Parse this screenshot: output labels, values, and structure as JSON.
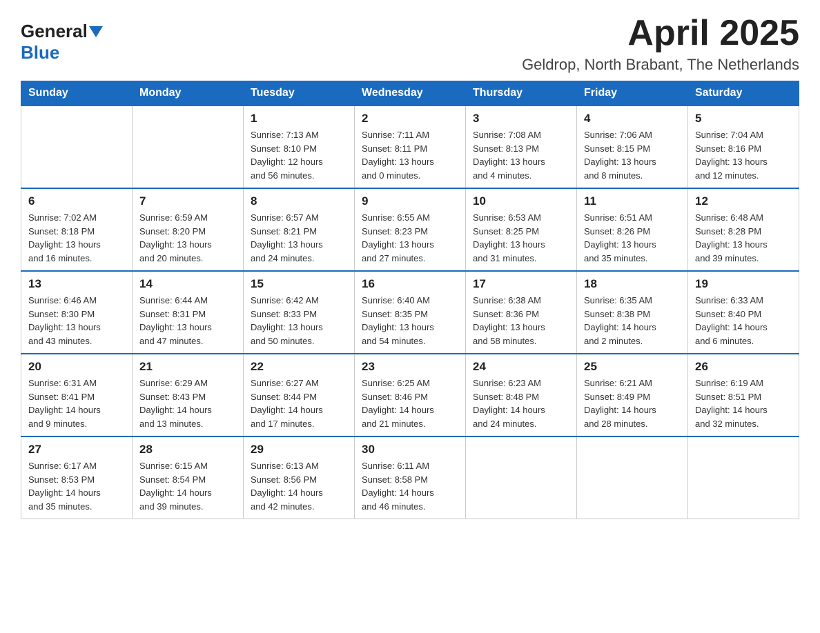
{
  "logo": {
    "general": "General",
    "blue": "Blue"
  },
  "header": {
    "month_year": "April 2025",
    "location": "Geldrop, North Brabant, The Netherlands"
  },
  "weekdays": [
    "Sunday",
    "Monday",
    "Tuesday",
    "Wednesday",
    "Thursday",
    "Friday",
    "Saturday"
  ],
  "weeks": [
    [
      {
        "day": "",
        "info": ""
      },
      {
        "day": "",
        "info": ""
      },
      {
        "day": "1",
        "info": "Sunrise: 7:13 AM\nSunset: 8:10 PM\nDaylight: 12 hours\nand 56 minutes."
      },
      {
        "day": "2",
        "info": "Sunrise: 7:11 AM\nSunset: 8:11 PM\nDaylight: 13 hours\nand 0 minutes."
      },
      {
        "day": "3",
        "info": "Sunrise: 7:08 AM\nSunset: 8:13 PM\nDaylight: 13 hours\nand 4 minutes."
      },
      {
        "day": "4",
        "info": "Sunrise: 7:06 AM\nSunset: 8:15 PM\nDaylight: 13 hours\nand 8 minutes."
      },
      {
        "day": "5",
        "info": "Sunrise: 7:04 AM\nSunset: 8:16 PM\nDaylight: 13 hours\nand 12 minutes."
      }
    ],
    [
      {
        "day": "6",
        "info": "Sunrise: 7:02 AM\nSunset: 8:18 PM\nDaylight: 13 hours\nand 16 minutes."
      },
      {
        "day": "7",
        "info": "Sunrise: 6:59 AM\nSunset: 8:20 PM\nDaylight: 13 hours\nand 20 minutes."
      },
      {
        "day": "8",
        "info": "Sunrise: 6:57 AM\nSunset: 8:21 PM\nDaylight: 13 hours\nand 24 minutes."
      },
      {
        "day": "9",
        "info": "Sunrise: 6:55 AM\nSunset: 8:23 PM\nDaylight: 13 hours\nand 27 minutes."
      },
      {
        "day": "10",
        "info": "Sunrise: 6:53 AM\nSunset: 8:25 PM\nDaylight: 13 hours\nand 31 minutes."
      },
      {
        "day": "11",
        "info": "Sunrise: 6:51 AM\nSunset: 8:26 PM\nDaylight: 13 hours\nand 35 minutes."
      },
      {
        "day": "12",
        "info": "Sunrise: 6:48 AM\nSunset: 8:28 PM\nDaylight: 13 hours\nand 39 minutes."
      }
    ],
    [
      {
        "day": "13",
        "info": "Sunrise: 6:46 AM\nSunset: 8:30 PM\nDaylight: 13 hours\nand 43 minutes."
      },
      {
        "day": "14",
        "info": "Sunrise: 6:44 AM\nSunset: 8:31 PM\nDaylight: 13 hours\nand 47 minutes."
      },
      {
        "day": "15",
        "info": "Sunrise: 6:42 AM\nSunset: 8:33 PM\nDaylight: 13 hours\nand 50 minutes."
      },
      {
        "day": "16",
        "info": "Sunrise: 6:40 AM\nSunset: 8:35 PM\nDaylight: 13 hours\nand 54 minutes."
      },
      {
        "day": "17",
        "info": "Sunrise: 6:38 AM\nSunset: 8:36 PM\nDaylight: 13 hours\nand 58 minutes."
      },
      {
        "day": "18",
        "info": "Sunrise: 6:35 AM\nSunset: 8:38 PM\nDaylight: 14 hours\nand 2 minutes."
      },
      {
        "day": "19",
        "info": "Sunrise: 6:33 AM\nSunset: 8:40 PM\nDaylight: 14 hours\nand 6 minutes."
      }
    ],
    [
      {
        "day": "20",
        "info": "Sunrise: 6:31 AM\nSunset: 8:41 PM\nDaylight: 14 hours\nand 9 minutes."
      },
      {
        "day": "21",
        "info": "Sunrise: 6:29 AM\nSunset: 8:43 PM\nDaylight: 14 hours\nand 13 minutes."
      },
      {
        "day": "22",
        "info": "Sunrise: 6:27 AM\nSunset: 8:44 PM\nDaylight: 14 hours\nand 17 minutes."
      },
      {
        "day": "23",
        "info": "Sunrise: 6:25 AM\nSunset: 8:46 PM\nDaylight: 14 hours\nand 21 minutes."
      },
      {
        "day": "24",
        "info": "Sunrise: 6:23 AM\nSunset: 8:48 PM\nDaylight: 14 hours\nand 24 minutes."
      },
      {
        "day": "25",
        "info": "Sunrise: 6:21 AM\nSunset: 8:49 PM\nDaylight: 14 hours\nand 28 minutes."
      },
      {
        "day": "26",
        "info": "Sunrise: 6:19 AM\nSunset: 8:51 PM\nDaylight: 14 hours\nand 32 minutes."
      }
    ],
    [
      {
        "day": "27",
        "info": "Sunrise: 6:17 AM\nSunset: 8:53 PM\nDaylight: 14 hours\nand 35 minutes."
      },
      {
        "day": "28",
        "info": "Sunrise: 6:15 AM\nSunset: 8:54 PM\nDaylight: 14 hours\nand 39 minutes."
      },
      {
        "day": "29",
        "info": "Sunrise: 6:13 AM\nSunset: 8:56 PM\nDaylight: 14 hours\nand 42 minutes."
      },
      {
        "day": "30",
        "info": "Sunrise: 6:11 AM\nSunset: 8:58 PM\nDaylight: 14 hours\nand 46 minutes."
      },
      {
        "day": "",
        "info": ""
      },
      {
        "day": "",
        "info": ""
      },
      {
        "day": "",
        "info": ""
      }
    ]
  ]
}
